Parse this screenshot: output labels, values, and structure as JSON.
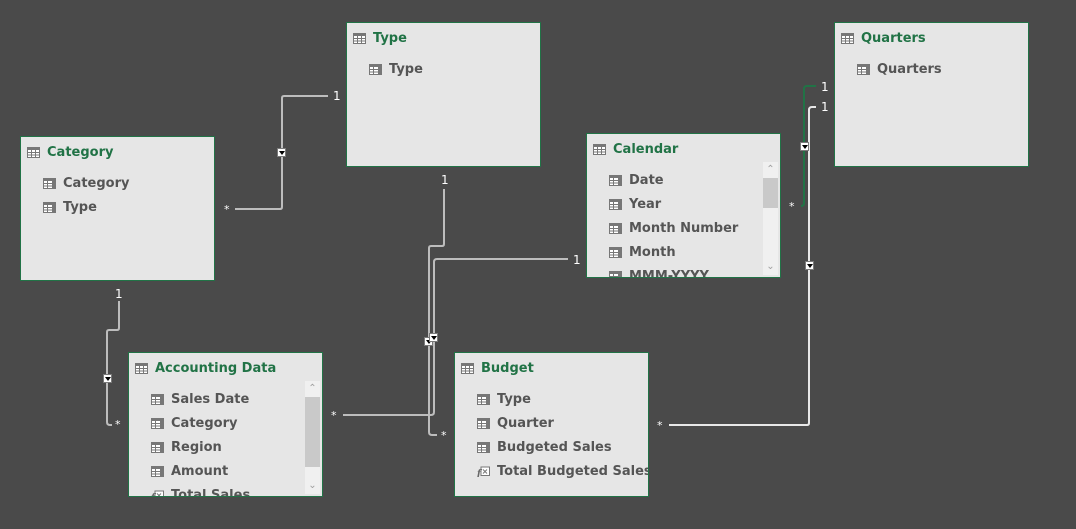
{
  "diagram": {
    "colors": {
      "background": "#4a4a4a",
      "table_bg": "#e6e6e6",
      "accent": "#217346",
      "field_text": "#555555",
      "link": "#bdbdbd",
      "link_selected": "#217346"
    },
    "tables": [
      {
        "id": "type",
        "title": "Type",
        "icon": "table-icon",
        "fields": [
          {
            "label": "Type",
            "icon": "column-icon"
          }
        ],
        "scrollable": false
      },
      {
        "id": "category",
        "title": "Category",
        "icon": "table-icon",
        "fields": [
          {
            "label": "Category",
            "icon": "column-icon"
          },
          {
            "label": "Type",
            "icon": "column-icon"
          }
        ],
        "scrollable": false
      },
      {
        "id": "calendar",
        "title": "Calendar",
        "icon": "table-icon",
        "fields": [
          {
            "label": "Date",
            "icon": "column-icon"
          },
          {
            "label": "Year",
            "icon": "column-icon"
          },
          {
            "label": "Month Number",
            "icon": "column-icon"
          },
          {
            "label": "Month",
            "icon": "column-icon"
          },
          {
            "label": "MMM-YYYY",
            "icon": "column-icon"
          }
        ],
        "scrollable": true,
        "scroll_position": 0
      },
      {
        "id": "quarters",
        "title": "Quarters",
        "icon": "table-icon",
        "fields": [
          {
            "label": "Quarters",
            "icon": "column-icon"
          }
        ],
        "scrollable": false
      },
      {
        "id": "accounting",
        "title": "Accounting Data",
        "icon": "table-icon",
        "fields": [
          {
            "label": "Sales Date",
            "icon": "column-icon"
          },
          {
            "label": "Category",
            "icon": "column-icon"
          },
          {
            "label": "Region",
            "icon": "column-icon"
          },
          {
            "label": "Amount",
            "icon": "column-icon"
          },
          {
            "label": "Total Sales",
            "icon": "measure-icon"
          }
        ],
        "scrollable": true,
        "scroll_position": 0
      },
      {
        "id": "budget",
        "title": "Budget",
        "icon": "table-icon",
        "fields": [
          {
            "label": "Type",
            "icon": "column-icon"
          },
          {
            "label": "Quarter",
            "icon": "column-icon"
          },
          {
            "label": "Budgeted Sales",
            "icon": "column-icon"
          },
          {
            "label": "Total Budgeted Sales",
            "icon": "measure-icon"
          }
        ],
        "scrollable": false
      }
    ],
    "relationships": [
      {
        "from": "category",
        "to": "type",
        "from_cardinality": "*",
        "to_cardinality": "1",
        "direction": "single",
        "selected": false
      },
      {
        "from": "accounting",
        "to": "category",
        "from_cardinality": "*",
        "to_cardinality": "1",
        "direction": "single",
        "selected": false
      },
      {
        "from": "budget",
        "to": "type",
        "from_cardinality": "*",
        "to_cardinality": "1",
        "direction": "single",
        "selected": false
      },
      {
        "from": "accounting",
        "to": "calendar",
        "from_cardinality": "*",
        "to_cardinality": "1",
        "direction": "single",
        "selected": false
      },
      {
        "from": "calendar",
        "to": "quarters",
        "from_cardinality": "*",
        "to_cardinality": "1",
        "direction": "single",
        "selected": true
      },
      {
        "from": "budget",
        "to": "quarters",
        "from_cardinality": "*",
        "to_cardinality": "1",
        "direction": "single",
        "selected": false
      }
    ],
    "labels": {
      "one": "1",
      "many": "*"
    }
  }
}
